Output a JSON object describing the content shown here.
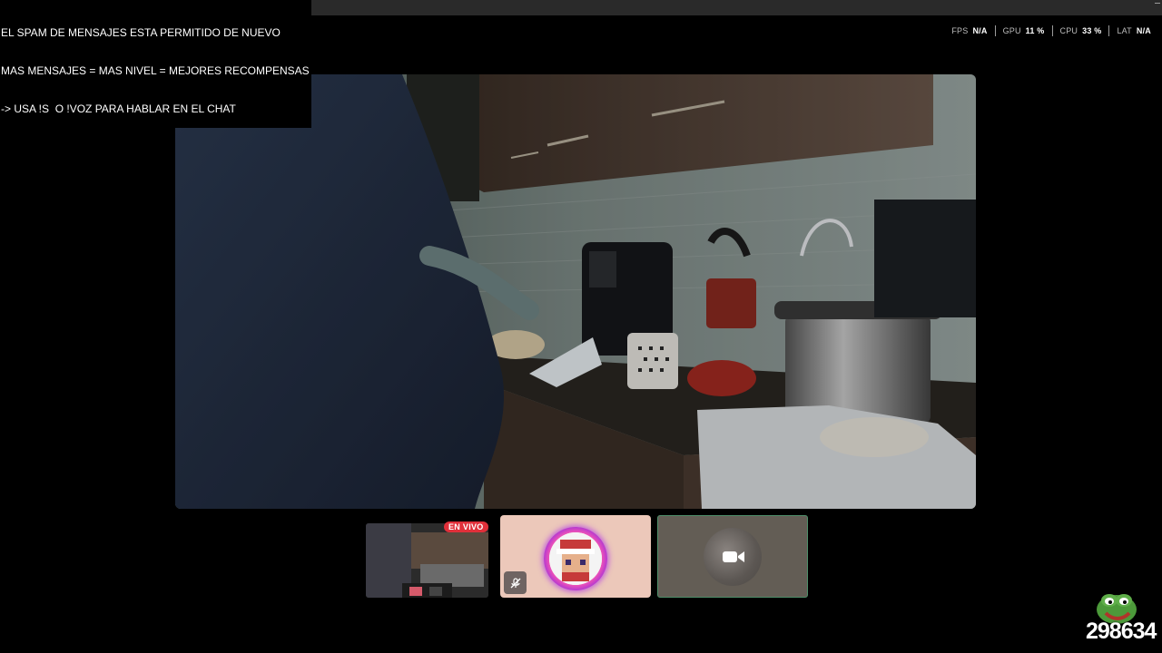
{
  "overlay": {
    "lines": [
      "EL SPAM DE MENSAJES ESTA PERMITIDO DE NUEVO",
      "MAS MENSAJES = MAS NIVEL = MEJORES RECOMPENSAS",
      "-> USA !S  O !VOZ PARA HABLAR EN EL CHAT"
    ]
  },
  "stats": [
    {
      "label": "FPS",
      "value": "N/A"
    },
    {
      "label": "GPU",
      "value": "11 %"
    },
    {
      "label": "CPU",
      "value": "33 %"
    },
    {
      "label": "LAT",
      "value": "N/A"
    }
  ],
  "thumbnails": {
    "live_badge": "EN VIVO",
    "avatar_mic": "mic-muted-icon",
    "camera": "video-camera-icon"
  },
  "sticker": {
    "text": "298634",
    "icon": "pepe-frog-icon"
  },
  "colors": {
    "live_badge": "#e0303a",
    "avatar_ring": "#a230d8",
    "cam_border": "#4e8f6a"
  }
}
